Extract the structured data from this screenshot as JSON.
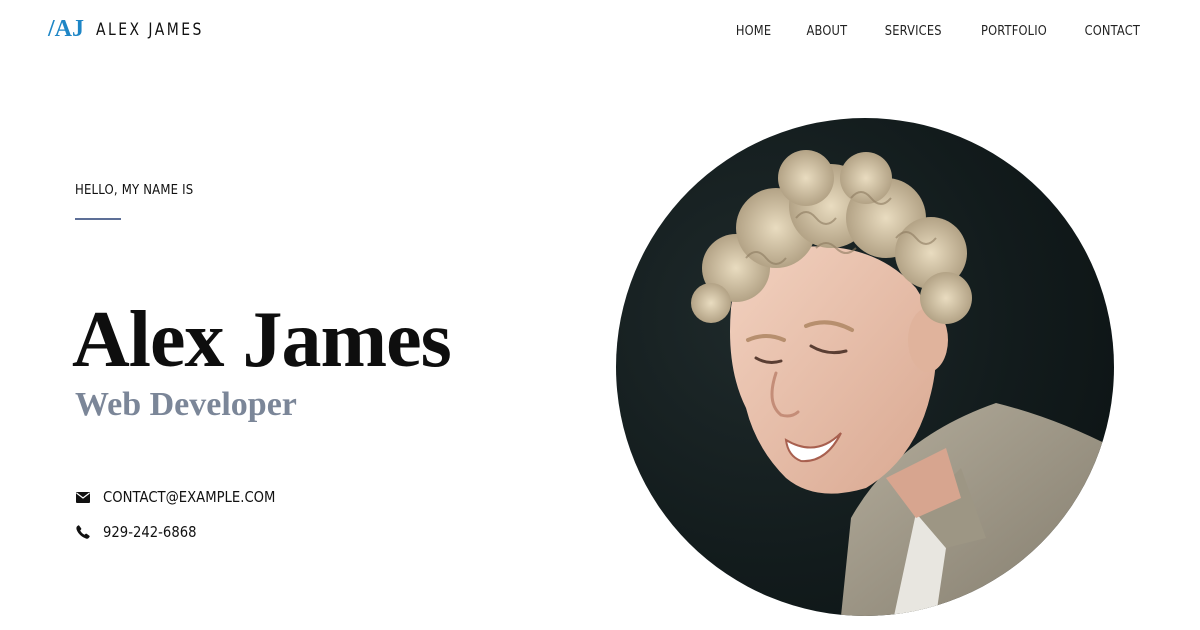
{
  "header": {
    "logo_mark": "/AJ",
    "logo_text": "ALEX JAMES",
    "nav": [
      "HOME",
      "ABOUT",
      "SERVICES",
      "PORTFOLIO",
      "CONTACT"
    ]
  },
  "hero": {
    "greeting": "HELLO, MY NAME IS",
    "name": "Alex James",
    "role": "Web Developer",
    "email": "CONTACT@EXAMPLE.COM",
    "phone": "929-242-6868"
  },
  "colors": {
    "accent": "#1e86c6",
    "role_text": "#7b8698",
    "greeting_line": "#5d6f97",
    "photo_background": "#121b1c"
  },
  "icons": {
    "email": "envelope-icon",
    "phone": "phone-icon"
  }
}
